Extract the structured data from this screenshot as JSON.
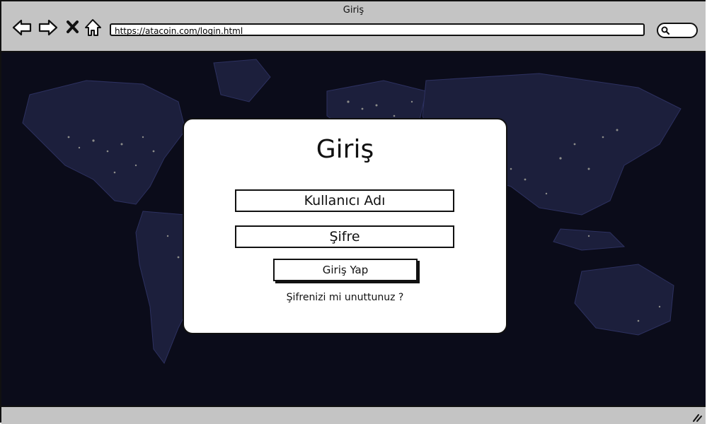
{
  "window": {
    "title": "Giriş"
  },
  "browser": {
    "url": "https://atacoin.com/login.html"
  },
  "login": {
    "heading": "Giriş",
    "username_label": "Kullanıcı Adı",
    "password_label": "Şifre",
    "submit_label": "Giriş Yap",
    "forgot_label": "Şifrenizi mi unuttunuz ?"
  },
  "icons": {
    "back": "arrow-left-icon",
    "forward": "arrow-right-icon",
    "stop": "close-icon",
    "home": "home-icon",
    "search": "search-icon",
    "resize": "resize-grip-icon"
  },
  "colors": {
    "chrome": "#c4c4c4",
    "background": "#0b0c1a"
  }
}
